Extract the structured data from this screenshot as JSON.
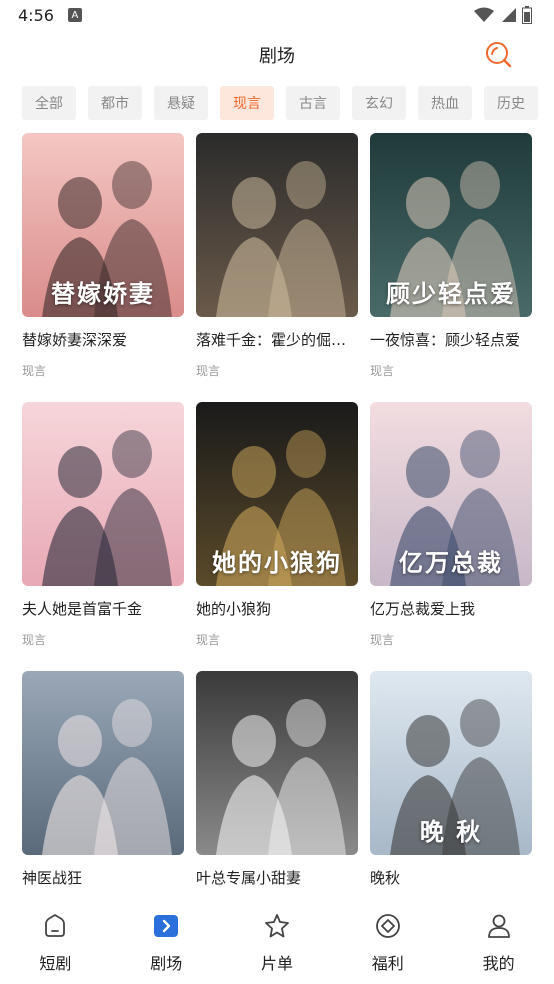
{
  "status_bar": {
    "time": "4:56",
    "a_badge": "A"
  },
  "header": {
    "title": "剧场"
  },
  "categories": [
    {
      "label": "全部",
      "active": false
    },
    {
      "label": "都市",
      "active": false
    },
    {
      "label": "悬疑",
      "active": false
    },
    {
      "label": "现言",
      "active": true
    },
    {
      "label": "古言",
      "active": false
    },
    {
      "label": "玄幻",
      "active": false
    },
    {
      "label": "热血",
      "active": false
    },
    {
      "label": "历史",
      "active": false
    }
  ],
  "dramas": [
    {
      "title": "替嫁娇妻深深爱",
      "genre": "现言",
      "poster_caption": "替嫁娇妻"
    },
    {
      "title": "落难千金：霍少的倔强娇妻",
      "genre": "现言",
      "poster_caption": ""
    },
    {
      "title": "一夜惊喜：顾少轻点爱",
      "genre": "现言",
      "poster_caption": "顾少轻点爱"
    },
    {
      "title": "夫人她是首富千金",
      "genre": "现言",
      "poster_caption": ""
    },
    {
      "title": "她的小狼狗",
      "genre": "现言",
      "poster_caption": "她的小狼狗"
    },
    {
      "title": "亿万总裁爱上我",
      "genre": "现言",
      "poster_caption": "亿万总裁"
    },
    {
      "title": "神医战狂",
      "genre": "",
      "poster_caption": ""
    },
    {
      "title": "叶总专属小甜妻",
      "genre": "",
      "poster_caption": ""
    },
    {
      "title": "晚秋",
      "genre": "",
      "poster_caption": "晚 秋"
    }
  ],
  "bottom_nav": [
    {
      "label": "短剧",
      "icon": "home-icon"
    },
    {
      "label": "剧场",
      "icon": "theater-icon"
    },
    {
      "label": "片单",
      "icon": "star-icon"
    },
    {
      "label": "福利",
      "icon": "gift-icon"
    },
    {
      "label": "我的",
      "icon": "user-icon"
    }
  ],
  "colors": {
    "accent": "#f06a2e",
    "active_tab_bg": "#fde6dc",
    "tab_bg": "#f2f2f2",
    "theater_icon_bg": "#2a6fdb"
  }
}
